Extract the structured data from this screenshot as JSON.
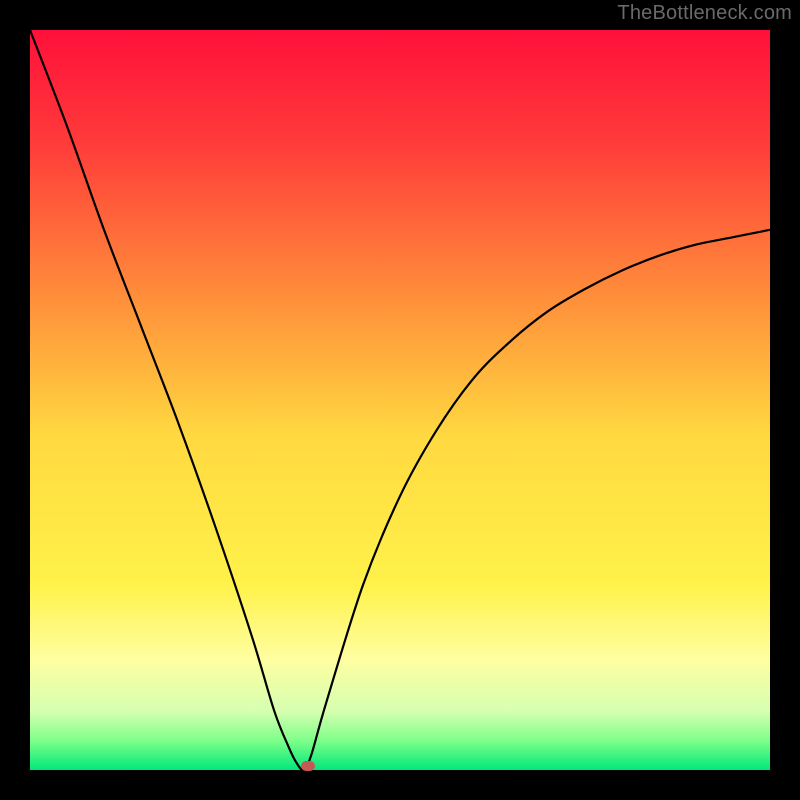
{
  "watermark": "TheBottleneck.com",
  "chart_data": {
    "type": "line",
    "title": "",
    "xlabel": "",
    "ylabel": "",
    "xlim": [
      0,
      100
    ],
    "ylim": [
      0,
      100
    ],
    "grid": false,
    "background": {
      "type": "vertical-gradient",
      "stops": [
        {
          "pos": 0.0,
          "color": "#ff103a"
        },
        {
          "pos": 0.15,
          "color": "#ff3a3a"
        },
        {
          "pos": 0.35,
          "color": "#ff8a3a"
        },
        {
          "pos": 0.55,
          "color": "#ffd940"
        },
        {
          "pos": 0.75,
          "color": "#fff24a"
        },
        {
          "pos": 0.85,
          "color": "#fffea0"
        },
        {
          "pos": 0.92,
          "color": "#d6ffb0"
        },
        {
          "pos": 0.96,
          "color": "#7fff8a"
        },
        {
          "pos": 1.0,
          "color": "#00e87a"
        }
      ]
    },
    "curve": {
      "comment": "x in 0..100, y = bottleneck% (0 at optimum). Piecewise: left branch nearly linear, right branch concave rising.",
      "minimum_x": 37,
      "x": [
        0,
        5,
        10,
        15,
        20,
        25,
        30,
        33,
        35,
        36,
        37,
        38,
        40,
        45,
        50,
        55,
        60,
        65,
        70,
        75,
        80,
        85,
        90,
        95,
        100
      ],
      "y": [
        100,
        87,
        73,
        60,
        47,
        33,
        18,
        8,
        3,
        1,
        0,
        2,
        9,
        25,
        37,
        46,
        53,
        58,
        62,
        65,
        67.5,
        69.5,
        71,
        72,
        73
      ]
    },
    "marker": {
      "x": 37.5,
      "y": 0.5,
      "color": "#c45a55"
    }
  }
}
